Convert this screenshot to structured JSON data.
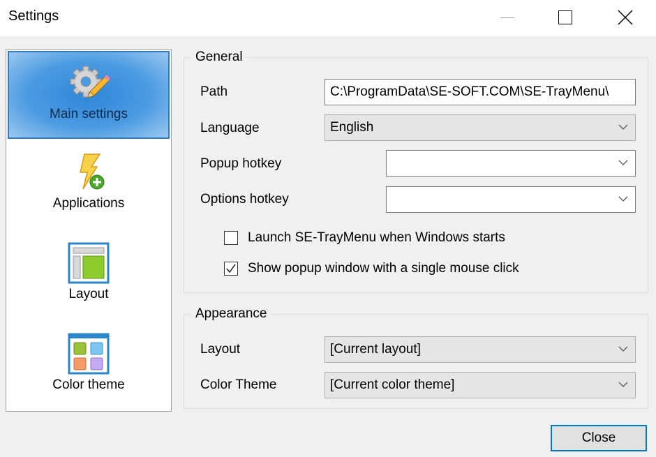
{
  "window": {
    "title": "Settings",
    "controls": {
      "minimize": "minimize",
      "maximize": "maximize",
      "close": "close"
    }
  },
  "sidebar": {
    "items": [
      {
        "label": "Main settings",
        "icon": "gear-pencil-icon",
        "active": true
      },
      {
        "label": "Applications",
        "icon": "lightning-add-icon",
        "active": false
      },
      {
        "label": "Layout",
        "icon": "layout-icon",
        "active": false
      },
      {
        "label": "Color theme",
        "icon": "color-theme-icon",
        "active": false
      }
    ]
  },
  "general": {
    "legend": "General",
    "path": {
      "label": "Path",
      "value": "C:\\ProgramData\\SE-SOFT.COM\\SE-TrayMenu\\"
    },
    "language": {
      "label": "Language",
      "value": "English"
    },
    "popup_hotkey": {
      "label": "Popup hotkey",
      "value": ""
    },
    "options_hotkey": {
      "label": "Options hotkey",
      "value": ""
    },
    "launch_on_start": {
      "label": "Launch SE-TrayMenu when Windows starts",
      "checked": false
    },
    "single_click": {
      "label": "Show popup window with a single mouse click",
      "checked": true
    }
  },
  "appearance": {
    "legend": "Appearance",
    "layout": {
      "label": "Layout",
      "value": "[Current layout]"
    },
    "color_theme": {
      "label": "Color Theme",
      "value": "[Current color theme]"
    }
  },
  "footer": {
    "close_label": "Close"
  },
  "colors": {
    "accent": "#0078d7",
    "selection": "#2f86d8"
  }
}
